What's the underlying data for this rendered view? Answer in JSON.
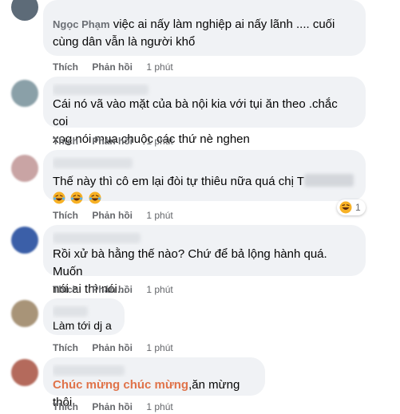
{
  "comments": [
    {
      "name": "Ngọc Phạm",
      "text_lines": [
        "việc ai nấy làm nghiệp ai nấy lãnh .... cuối",
        "cùng dân vẫn là người khổ"
      ],
      "actions": {
        "like": "Thích",
        "reply": "Phản hồi",
        "time": "1 phút"
      },
      "avatar_color": "#5d6b78"
    },
    {
      "name": "",
      "text_lines": [
        "Cái nó vã vào mặt của bà nội kia với tụi ăn theo .chắc coi",
        "xog nói mua chuộc các thứ nè nghen"
      ],
      "actions": {
        "like": "Thích",
        "reply": "Phản hồi",
        "time": "1 phút"
      },
      "avatar_color": "#8aa0a8"
    },
    {
      "name": "",
      "text_line": "Thế này thì cô em lại đòi tự thiêu nữa quá chị T",
      "emoji_count": 3,
      "actions": {
        "like": "Thích",
        "reply": "Phản hồi",
        "time": "1 phút"
      },
      "reaction_count": "1",
      "avatar_color": "#c9a4a4"
    },
    {
      "name": "",
      "text_lines": [
        "Rồi xử bà hằng thế nào? Chứ để bả lộng hành quá. Muốn",
        "nói ai thì nói..."
      ],
      "actions": {
        "like": "Thích",
        "reply": "Phản hồi",
        "time": "1 phút"
      },
      "avatar_color": "#3b5fa8"
    },
    {
      "name": "",
      "text_line": "Làm tới dj a",
      "actions": {
        "like": "Thích",
        "reply": "Phản hồi",
        "time": "1 phút"
      },
      "avatar_color": "#a89478"
    },
    {
      "name": "",
      "highlight": "Chúc mừng chúc mừng",
      "text_rest": ",ăn mừng thôi",
      "actions": {
        "like": "Thích",
        "reply": "Phản hồi",
        "time": "1 phút"
      },
      "avatar_color": "#b46a5c"
    }
  ],
  "colors": {
    "bubble": "#f0f2f5",
    "meta": "#65676b",
    "highlight": "#e0734a"
  }
}
